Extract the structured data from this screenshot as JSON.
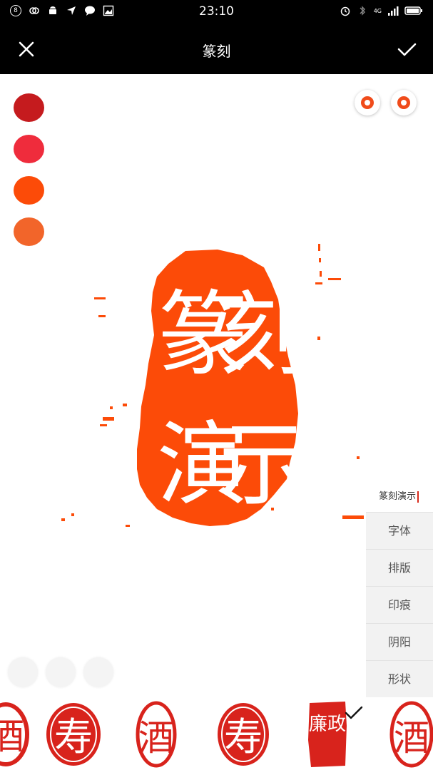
{
  "status_bar": {
    "notification_count": "8",
    "time": "23:10",
    "network": "4G"
  },
  "app_bar": {
    "title": "篆刻",
    "close_icon": "close-icon",
    "confirm_icon": "check-icon"
  },
  "palette": {
    "colors": [
      "#c51b1e",
      "#ef2c3c",
      "#fc4b08",
      "#f2652a"
    ]
  },
  "seal": {
    "color": "#fc4b08",
    "characters": [
      "篆",
      "刻",
      "演",
      "示"
    ]
  },
  "text_preview": "篆刻演示",
  "menu": {
    "items": [
      "字体",
      "排版",
      "印痕",
      "阴阳",
      "形状"
    ]
  },
  "templates": {
    "selected_index": 4,
    "items": [
      {
        "chars": "酒"
      },
      {
        "chars": "寿"
      },
      {
        "chars": "酒"
      },
      {
        "chars": "寿"
      },
      {
        "chars": "廉政"
      },
      {
        "chars": "酒"
      }
    ]
  }
}
